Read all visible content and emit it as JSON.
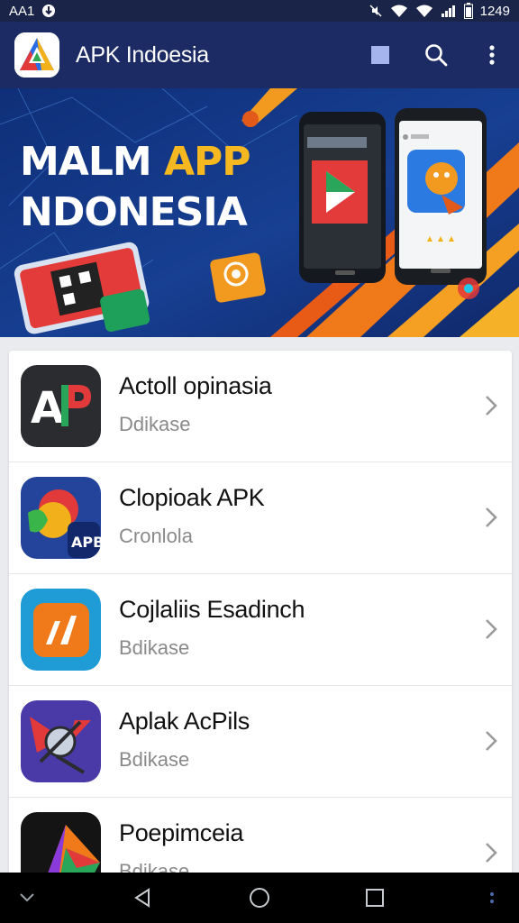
{
  "status_bar": {
    "left_text": "AA1",
    "left_icon": "pin-icon",
    "time": "1249",
    "icons": [
      "mute-icon",
      "wifi-icon",
      "wifi-icon",
      "signal-icon",
      "battery-icon"
    ]
  },
  "app_bar": {
    "title": "APK Indoesia",
    "logo_icon": "apk-logo-icon",
    "actions": [
      "square-icon",
      "search-icon",
      "overflow-menu-icon"
    ]
  },
  "banner": {
    "line1_main": "MALM ",
    "line1_accent": "APP",
    "line2": "NDONESIA",
    "accent_color": "#f6b820"
  },
  "apps": [
    {
      "title": "Actoll opinasia",
      "subtitle": "Ddikase",
      "icon": "ap-logo-icon"
    },
    {
      "title": "Clopioak APK",
      "subtitle": "Cronlola",
      "icon": "chat-bird-icon"
    },
    {
      "title": "Cojlaliis Esadinch",
      "subtitle": "Bdikase",
      "icon": "orange-app-icon"
    },
    {
      "title": "Aplak AcPils",
      "subtitle": "Bdikase",
      "icon": "compass-satellite-icon"
    },
    {
      "title": "Poepimceia",
      "subtitle": "Bdikase",
      "icon": "colorful-triangle-icon"
    }
  ],
  "nav_bar": [
    "collapse-icon",
    "back-icon",
    "home-icon",
    "recents-icon",
    "overflow-icon"
  ],
  "colors": {
    "app_bar": "#1c2b63",
    "status_bar": "#1a2348",
    "background": "#e9ebef"
  }
}
